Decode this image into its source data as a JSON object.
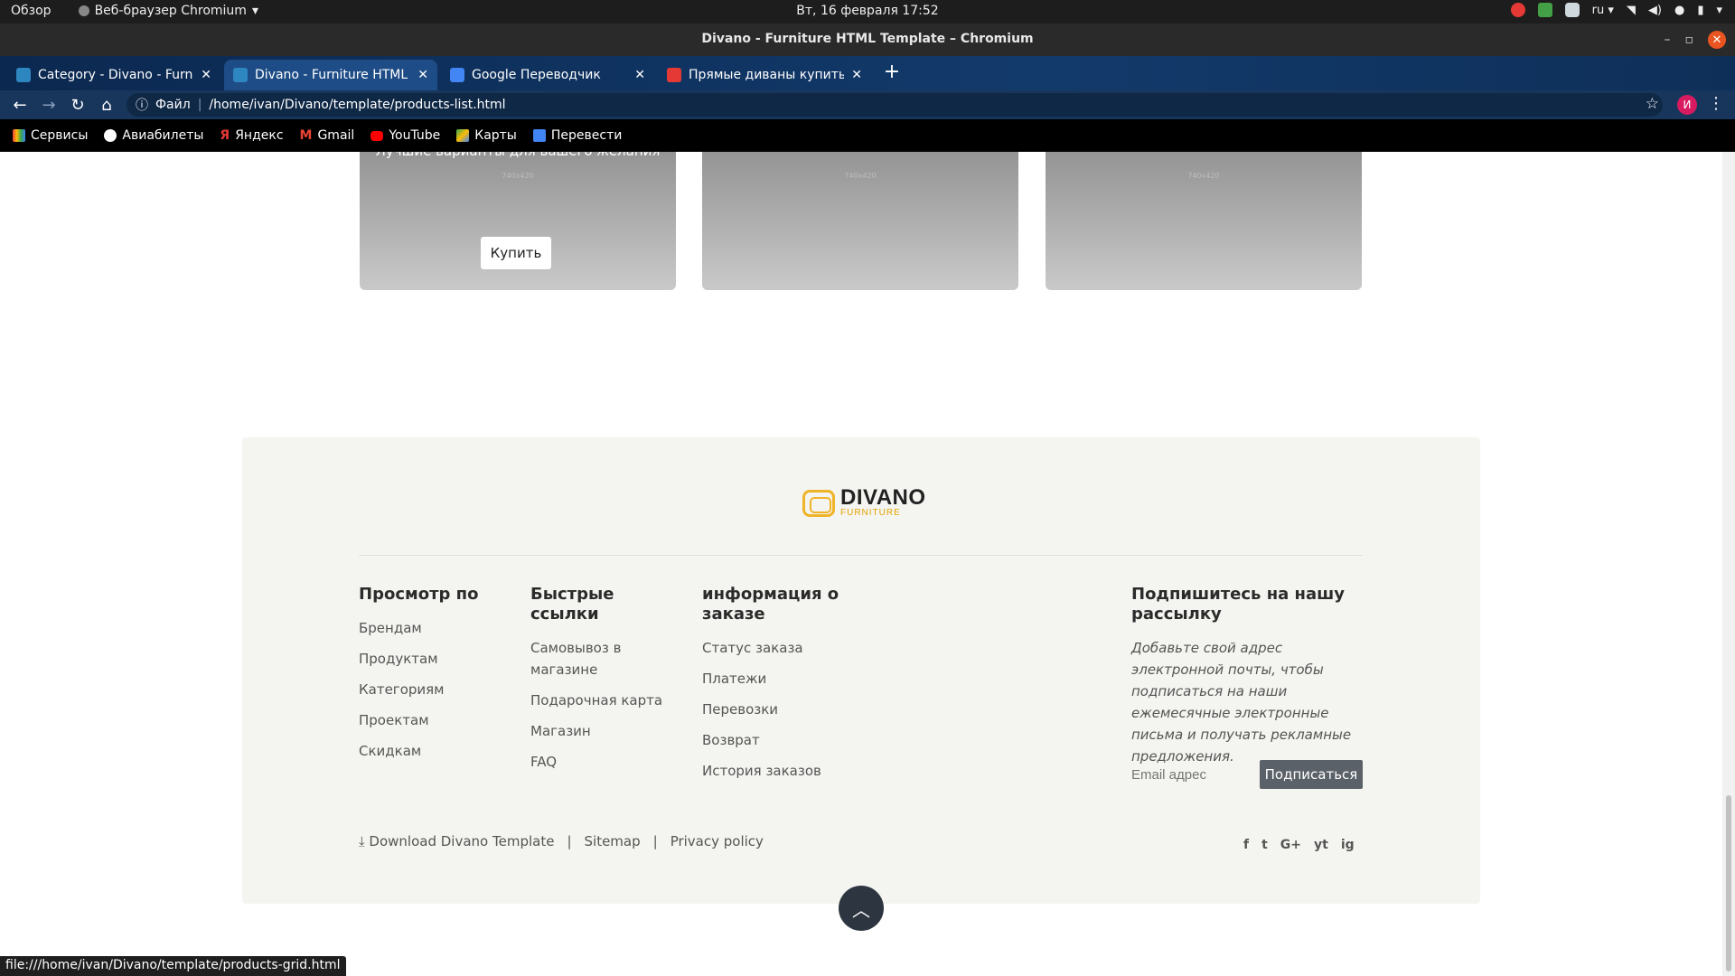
{
  "system": {
    "activities": "Обзор",
    "app_name": "Веб-браузер Chromium",
    "datetime": "Вт, 16 февраля  17:52",
    "lang": "ru"
  },
  "window": {
    "title": "Divano - Furniture HTML Template – Chromium"
  },
  "tabs": [
    {
      "label": "Category - Divano - Furnit",
      "active": false,
      "icon_color": "#2e86c1"
    },
    {
      "label": "Divano - Furniture HTML T",
      "active": true,
      "icon_color": "#2e86c1"
    },
    {
      "label": "Google Переводчик",
      "active": false,
      "icon_color": "#4285f4"
    },
    {
      "label": "Прямые диваны купить в",
      "active": false,
      "icon_color": "#e53935"
    }
  ],
  "toolbar": {
    "info_label": "Файл",
    "url": "/home/ivan/Divano/template/products-list.html",
    "profile_initial": "И"
  },
  "bookmarks": [
    {
      "label": "Сервисы",
      "icon": "apps-icon",
      "color": "#e53935"
    },
    {
      "label": "Авиабилеты",
      "icon": "globe-icon",
      "color": "#ffffff"
    },
    {
      "label": "Яндекс",
      "icon": "yandex-icon",
      "color": "#e53935"
    },
    {
      "label": "Gmail",
      "icon": "gmail-icon",
      "color": "#ea4335"
    },
    {
      "label": "YouTube",
      "icon": "youtube-icon",
      "color": "#ff0000"
    },
    {
      "label": "Карты",
      "icon": "maps-icon",
      "color": "#34a853"
    },
    {
      "label": "Перевести",
      "icon": "translate-icon",
      "color": "#4285f4"
    }
  ],
  "promos": [
    {
      "subtitle": "Лучшие варианты для вашего желания",
      "placeholder": "740x420",
      "button": "Купить"
    },
    {
      "subtitle": "",
      "placeholder": "740x420",
      "button": ""
    },
    {
      "subtitle": "",
      "placeholder": "740x420",
      "button": ""
    }
  ],
  "footer": {
    "logo_title": "DIVANO",
    "logo_sub": "FURNITURE",
    "col1": {
      "title": "Просмотр по",
      "links": [
        "Брендам",
        "Продуктам",
        "Категориям",
        "Проектам",
        "Скидкам"
      ]
    },
    "col2": {
      "title": "Быстрые ссылки",
      "links": [
        "Самовывоз в магазине",
        "Подарочная карта",
        "Магазин",
        "FAQ"
      ]
    },
    "col3": {
      "title": "информация о заказе",
      "links": [
        "Статус заказа",
        "Платежи",
        "Перевозки",
        "Возврат",
        "История заказов"
      ]
    },
    "newsletter": {
      "title": "Подпишитесь на нашу рассылку",
      "text": "Добавьте свой адрес электронной почты, чтобы подписаться на наши ежемесячные электронные письма и получать рекламные предложения.",
      "placeholder": "Email адрес",
      "button": "Подписаться"
    },
    "bottom_links": {
      "download": "Download Divano Template",
      "sep": "|",
      "sitemap": "Sitemap",
      "privacy": "Privacy policy"
    },
    "social": [
      "f",
      "t",
      "G+",
      "yt",
      "ig"
    ]
  },
  "status_url": "file:///home/ivan/Divano/template/products-grid.html"
}
